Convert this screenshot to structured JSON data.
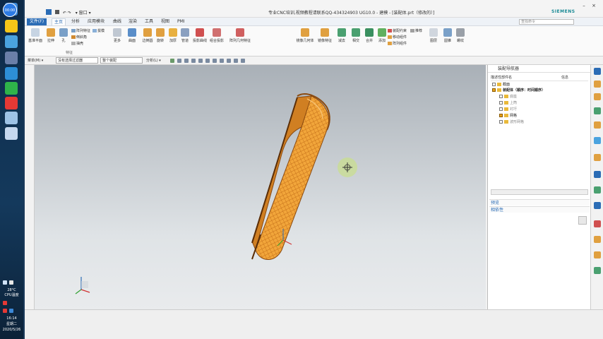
{
  "taskbar": {
    "weather_temp": "28°C",
    "weather_label": "CPU温度",
    "clock_time": "16:14",
    "clock_day": "星期二",
    "clock_date": "2020/5/26"
  },
  "recorder": {
    "label": "00:00"
  },
  "titlebar": {
    "quick_access": "▾ 窗口 ▾",
    "title": "专业CNC培训,视频教程请联系QQ-434324903 UG10.0 - 建模 - [装配体.prt（修改的）]",
    "brand": "SIEMENS"
  },
  "menubar": {
    "file": "文件(F)",
    "tabs": [
      "主页",
      "分析",
      "应用模块",
      "曲线",
      "渲染",
      "工具",
      "视图",
      "PMI"
    ],
    "search_placeholder": "查找命令"
  },
  "ribbon": {
    "big_buttons": [
      "基准平面",
      "拉伸",
      "孔",
      "更多",
      "曲面",
      "边倒圆",
      "旋转",
      "加厚",
      "管道",
      "投影曲线",
      "组合投影",
      "阵列几何特征",
      "镜像几何体",
      "镜像特征",
      "减去",
      "相交",
      "合并",
      "添加"
    ],
    "small_buttons": [
      "阵列特征",
      "倒斜角",
      "抽壳",
      "拔模"
    ],
    "small_right": [
      "装配约束",
      "移动组件",
      "阵列组件",
      "推荐"
    ],
    "extra_buttons": [
      "图层",
      "圆锥",
      "螺纹"
    ],
    "group_label": "特征"
  },
  "toolbar2": {
    "menu_label": "菜单(M) ▾",
    "filter_value": "没有选择过滤器",
    "assembly_value": "整个装配",
    "analysis_label": "分析(L) ▾"
  },
  "navigator": {
    "title": "装配导航器",
    "col_name": "描述性部件名",
    "col_info": "信息",
    "tree": [
      {
        "label": "截面",
        "checked": false
      },
      {
        "label": "装配体（顺序：时间顺序）",
        "checked": true
      },
      {
        "label": "底座",
        "checked": false
      },
      {
        "label": "上筒",
        "checked": false
      },
      {
        "label": "衬圩",
        "checked": false
      },
      {
        "label": "网格",
        "checked": true
      },
      {
        "label": "波形网格",
        "checked": false
      }
    ],
    "section_preview": "预览",
    "section_dependency": "相依性"
  },
  "colors": {
    "accent": "#2b6cb5",
    "part_orange": "#e08a1e",
    "part_dark": "#8a4a10"
  }
}
